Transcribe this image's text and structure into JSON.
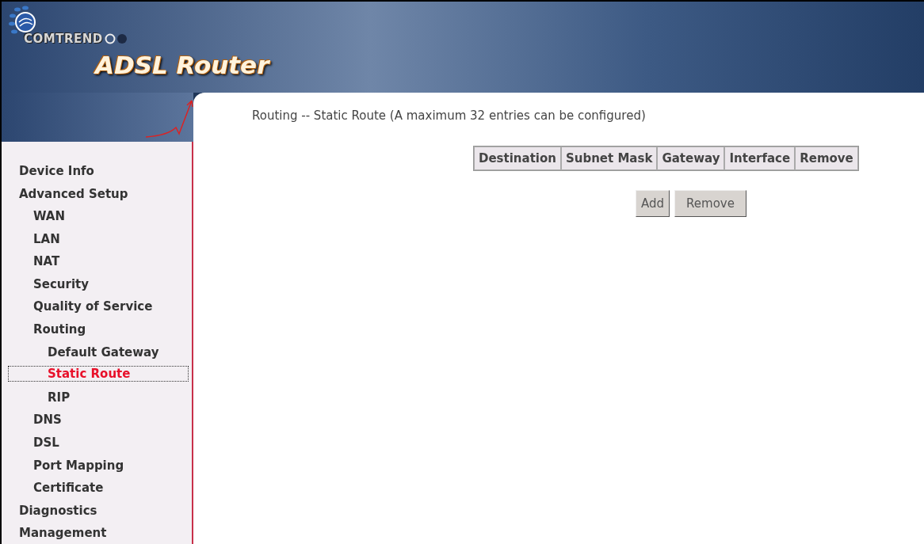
{
  "header": {
    "brand": "COMTREND",
    "product": "ADSL Router"
  },
  "sidebar": {
    "items": [
      {
        "label": "Device Info",
        "selected": false
      },
      {
        "label": "Advanced Setup",
        "selected": false,
        "children": [
          {
            "label": "WAN",
            "selected": false
          },
          {
            "label": "LAN",
            "selected": false
          },
          {
            "label": "NAT",
            "selected": false
          },
          {
            "label": "Security",
            "selected": false
          },
          {
            "label": "Quality of Service",
            "selected": false
          },
          {
            "label": "Routing",
            "selected": false,
            "children": [
              {
                "label": "Default Gateway",
                "selected": false
              },
              {
                "label": "Static Route",
                "selected": true
              },
              {
                "label": "RIP",
                "selected": false
              }
            ]
          },
          {
            "label": "DNS",
            "selected": false
          },
          {
            "label": "DSL",
            "selected": false
          },
          {
            "label": "Port Mapping",
            "selected": false
          },
          {
            "label": "Certificate",
            "selected": false
          }
        ]
      },
      {
        "label": "Diagnostics",
        "selected": false
      },
      {
        "label": "Management",
        "selected": false
      }
    ]
  },
  "page": {
    "title": "Routing -- Static Route (A maximum 32 entries can be configured)",
    "table": {
      "columns": [
        "Destination",
        "Subnet Mask",
        "Gateway",
        "Interface",
        "Remove"
      ]
    },
    "buttons": [
      "Add",
      "Remove"
    ]
  }
}
